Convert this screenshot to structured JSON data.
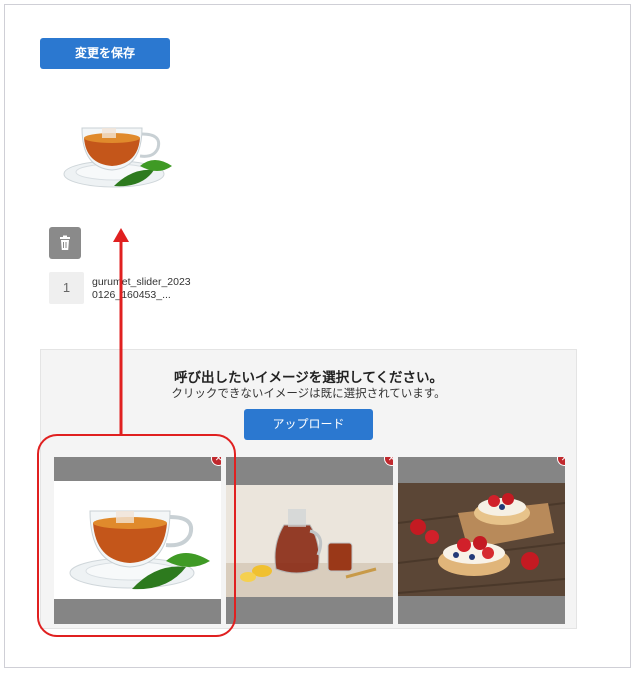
{
  "toolbar": {
    "save_label": "変更を保存"
  },
  "selected_image": {
    "index": "1",
    "filename": "gurumet_slider_20230126_160453_..."
  },
  "picker": {
    "title": "呼び出したいイメージを選択してください。",
    "subtitle": "クリックできないイメージは既に選択されています。",
    "upload_label": "アップロード",
    "thumbnails": [
      {
        "subject": "tea-cup"
      },
      {
        "subject": "tea-pot-and-cups"
      },
      {
        "subject": "strawberry-tarts"
      }
    ]
  },
  "icons": {
    "trash": "trash-icon",
    "remove": "remove-icon"
  },
  "colors": {
    "primary": "#2b78d0",
    "highlight": "#e02020",
    "remove": "#c0282d",
    "thumb_bg": "#858585"
  }
}
